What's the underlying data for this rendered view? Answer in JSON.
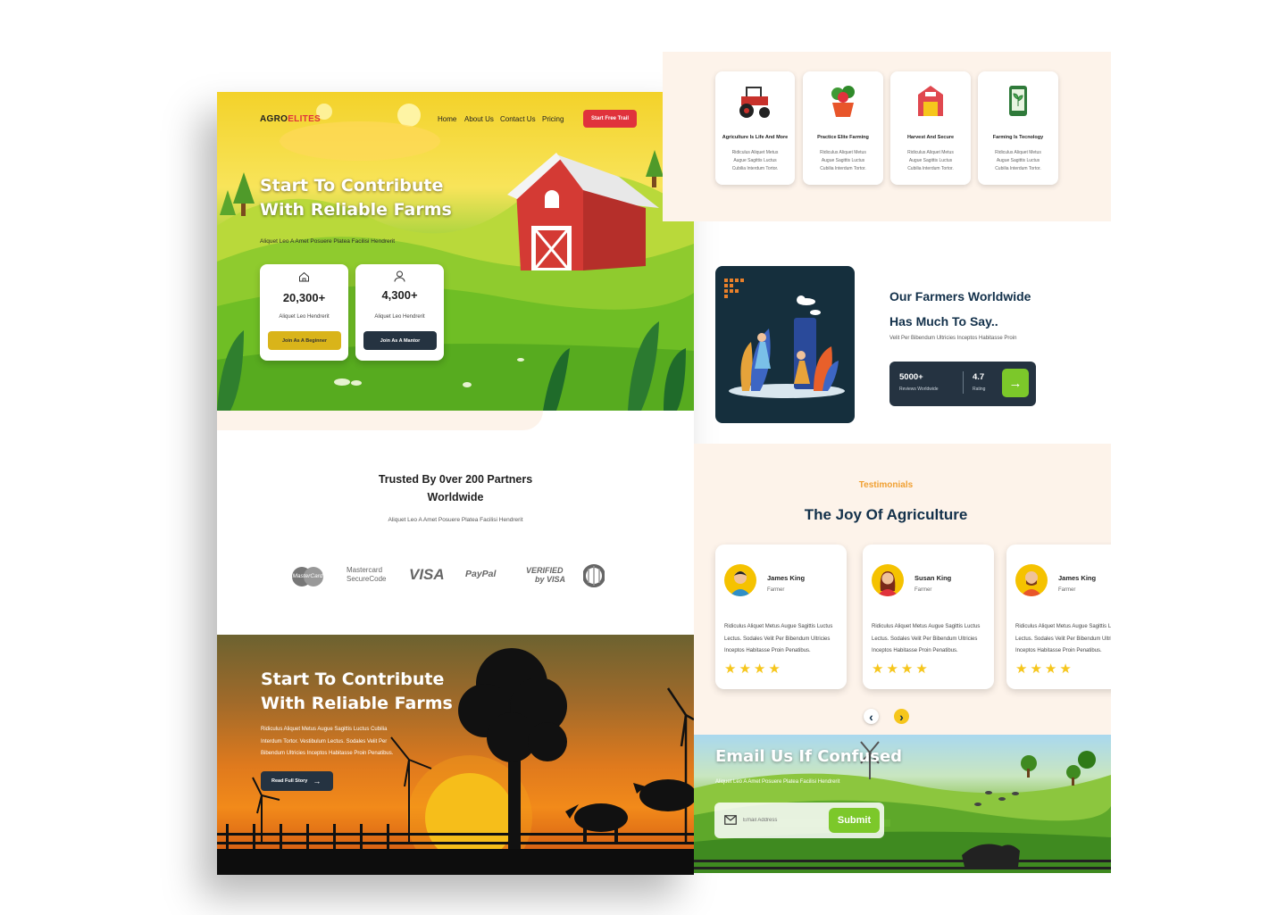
{
  "colors": {
    "brand_dark": "#222222",
    "brand_red": "#e0323c",
    "accent_yellow": "#d9b41a",
    "dark_slate": "#253341",
    "green_button": "#7cc82a",
    "peach_bg": "#fdf3ea",
    "testimonial_orange": "#f0a033",
    "heading_navy": "#12304a",
    "star_yellow": "#f6c61c"
  },
  "nav": {
    "logo_part1": "AGRO",
    "logo_part2": "ELITES",
    "links": [
      "Home",
      "About Us",
      "Contact Us",
      "Pricing"
    ],
    "cta": "Start Free Trail"
  },
  "hero": {
    "title_line1": "Start To Contribute",
    "title_line2": "With Reliable Farms",
    "subtitle": "Aliquet Leo A Amet Posuere Platea Facilisi Hendrerit",
    "cards": [
      {
        "icon": "home-icon",
        "value": "20,300+",
        "label": "Aliquet Leo Hendrerit",
        "button": "Join As A Beginner"
      },
      {
        "icon": "user-icon",
        "value": "4,300+",
        "label": "Aliquet Leo Hendrerit",
        "button": "Join As A Mantor"
      }
    ]
  },
  "partners": {
    "title_line1": "Trusted By  0ver 200 Partners",
    "title_line2": "Worldwide",
    "subtitle": "Aliquet Leo A Amet Posuere Platea Facilisi Hendrerit",
    "logos": [
      "MasterCard",
      "Mastercard",
      "SecureCode",
      "VISA",
      "PayPal",
      "VERIFIED",
      "by VISA"
    ]
  },
  "story": {
    "title_line1": "Start To Contribute",
    "title_line2": "With Reliable Farms",
    "text_line1": "Ridiculus Aliquet Metus Augue Sagittis Luctus Cubilia",
    "text_line2": "Interdum Tortor. Vestibulum Lectus. Sodales Velit Per",
    "text_line3": "Bibendum Ultricies Inceptos Habitasse Proin Penatibus.",
    "button": "Read Full Story"
  },
  "features": [
    {
      "icon": "tractor-icon",
      "title": "Agriculture Is Life And More",
      "lines": [
        "Ridiculus Aliquet Metus",
        "Augue Sagittis Luctus",
        "Cubilia Interdum Tortor."
      ]
    },
    {
      "icon": "plant-pot-icon",
      "title": "Practice Elite Farming",
      "lines": [
        "Ridiculus Aliquet Metus",
        "Augue Sagittis Luctus",
        "Cubilia Interdum Tortor."
      ]
    },
    {
      "icon": "barn-icon",
      "title": "Harvest And Secure",
      "lines": [
        "Ridiculus Aliquet Metus",
        "Augue Sagittis Luctus",
        "Cubilia Interdum Tortor."
      ]
    },
    {
      "icon": "smartphone-plant-icon",
      "title": "Farming Is Tecnology",
      "lines": [
        "Ridiculus Aliquet Metus",
        "Augue Sagittis Luctus",
        "Cubilia Interdum Tortor."
      ]
    }
  ],
  "farmers": {
    "title_line1": "Our Farmers Worldwide",
    "title_line2": "Has Much To Say..",
    "subtitle": "Velit Per Bibendum Ultricies Inceptos Habitasse Proin",
    "reviews_value": "5000+",
    "reviews_label": "Reviews Worldwide",
    "rating_value": "4.7",
    "rating_label": "Rating"
  },
  "testimonials": {
    "eyebrow": "Testimonials",
    "title": "The Joy Of Agriculture",
    "items": [
      {
        "name": "James King",
        "role": "Farmer",
        "line1": "Ridiculus Aliquet Metus Augue Sagittis Luctus",
        "line2": "Lectus. Sodales Velit Per Bibendum Ultricies",
        "line3": "Inceptos Habitasse Proin Penatibus.",
        "stars": "★★★★"
      },
      {
        "name": "Susan King",
        "role": "Farmer",
        "line1": "Ridiculus Aliquet Metus Augue Sagittis Luctus",
        "line2": "Lectus. Sodales Velit Per Bibendum Ultricies",
        "line3": "Inceptos Habitasse Proin Penatibus.",
        "stars": "★★★★"
      },
      {
        "name": "James King",
        "role": "Farmer",
        "line1": "Ridiculus Aliquet Metus Augue Sagittis Luctus",
        "line2": "Lectus. Sodales Velit Per Bibendum Ultricies",
        "line3": "Inceptos Habitasse Proin Penatibus.",
        "stars": "★★★★"
      }
    ],
    "prev": "‹",
    "next": "›"
  },
  "email": {
    "title": "Email Us If Confused",
    "subtitle": "Aliquet Leo A Amet Posuere Platea Facilisi Hendrerit",
    "placeholder": "Email Address",
    "button": "Submit"
  }
}
